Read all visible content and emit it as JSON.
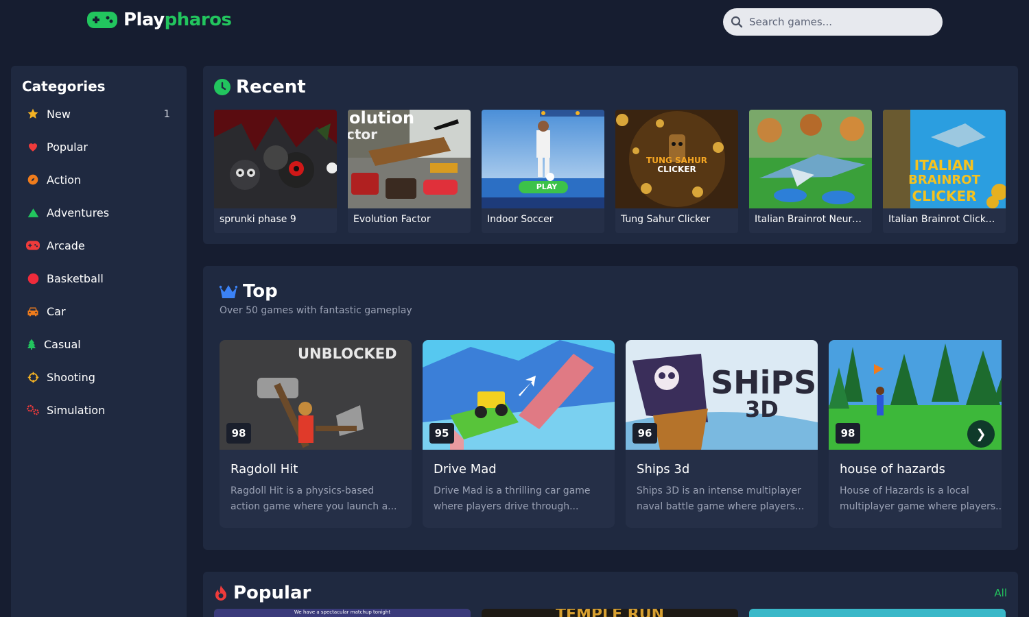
{
  "header": {
    "logo_play": "Play",
    "logo_pharos": "pharos",
    "search_placeholder": "Search games..."
  },
  "colors": {
    "background": "#161d30",
    "panel": "#1f2940",
    "card": "#252f47",
    "brand_green": "#22c55e",
    "muted_text": "#9aa1b4"
  },
  "sidebar": {
    "title": "Categories",
    "items": [
      {
        "label": "New",
        "icon": "star-icon",
        "count": "1"
      },
      {
        "label": "Popular",
        "icon": "heart-icon"
      },
      {
        "label": "Action",
        "icon": "compass-icon"
      },
      {
        "label": "Adventures",
        "icon": "mountain-icon"
      },
      {
        "label": "Arcade",
        "icon": "gamepad-icon"
      },
      {
        "label": "Basketball",
        "icon": "basketball-icon"
      },
      {
        "label": "Car",
        "icon": "car-icon"
      },
      {
        "label": "Casual",
        "icon": "tree-icon"
      },
      {
        "label": "Shooting",
        "icon": "crosshair-icon"
      },
      {
        "label": "Simulation",
        "icon": "gears-icon"
      }
    ]
  },
  "recent": {
    "title": "Recent",
    "icon": "clock-icon",
    "games": [
      {
        "title": "sprunki phase 9"
      },
      {
        "title": "Evolution Factor"
      },
      {
        "title": "Indoor Soccer"
      },
      {
        "title": "Tung Sahur Clicker"
      },
      {
        "title": "Italian Brainrot Neuro ..."
      },
      {
        "title": "Italian Brainrot Clicker..."
      }
    ],
    "thumb_text": {
      "evolution_line1": "olution",
      "evolution_line2": "ctor",
      "soccer_play": "PLAY",
      "tung_line1": "TUNG SAHUR",
      "tung_line2": "CLICKER",
      "brainrot_line1": "ITALIAN",
      "brainrot_line2": "BRAINROT",
      "brainrot_line3": "CLICKER"
    }
  },
  "top": {
    "title": "Top",
    "icon": "crown-icon",
    "subtitle": "Over 50 games with fantastic gameplay",
    "next_label": "❯",
    "games": [
      {
        "name": "Ragdoll Hit",
        "score": "98",
        "desc": "Ragdoll Hit is a physics-based action game where you launch a...",
        "thumb_text": "UNBLOCKED"
      },
      {
        "name": "Drive Mad",
        "score": "95",
        "desc": "Drive Mad is a thrilling car game where players drive through..."
      },
      {
        "name": "Ships 3d",
        "score": "96",
        "desc": "Ships 3D is an intense multiplayer naval battle game where players...",
        "thumb_text": "SHiPS",
        "thumb_text2": "3D"
      },
      {
        "name": "house of hazards",
        "score": "98",
        "desc": "House of Hazards is a local multiplayer game where players..."
      }
    ]
  },
  "popular": {
    "title": "Popular",
    "icon": "fire-icon",
    "all_label": "All",
    "thumb_text_1": "We have a spectacular matchup tonight",
    "thumb_text_2": "TEMPLE RUN"
  }
}
